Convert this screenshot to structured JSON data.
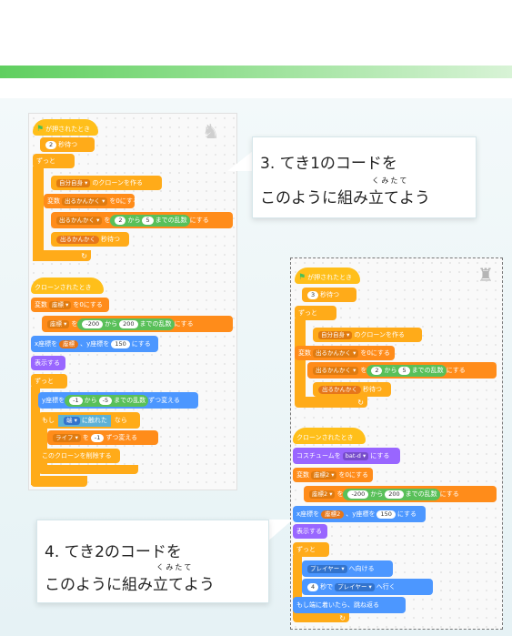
{
  "callout3": {
    "line1": "3.  てき1のコードを",
    "ruby": "くみたて",
    "line2": "このように組み立てよう"
  },
  "callout4": {
    "line1": "4.  てき2のコードを",
    "ruby": "くみたて",
    "line2": "このように組み立てよう"
  },
  "panel1": {
    "flag_hat": "が押されたとき",
    "wait_value": "2",
    "wait_label": "秒待つ",
    "forever": "ずっと",
    "clone_self": "自分自身 ▾",
    "clone_label": "のクローンを作る",
    "set_var": "変数",
    "set_var_name": "出るかんかく ▾",
    "set_var_to": "を0にする",
    "set_var_row": "出るかんかく ▾",
    "set_var_eq": "を",
    "rand_a": "2",
    "rand_from": "から",
    "rand_b": "5",
    "rand_label": "までの乱数",
    "rand_suffix": "にする",
    "wait_var": "出るかんかく",
    "wait_var_label": "秒待つ",
    "clone_hat": "クローンされたとき",
    "set2_var": "変数",
    "set2_name": "座標 ▾",
    "set2_label": "を0にする",
    "set2_row": "座標 ▾",
    "set2_eq": "を",
    "rand2_a": "-200",
    "rand2_from": "から",
    "rand2_b": "200",
    "rand2_label": "までの乱数",
    "rand2_suffix": "にする",
    "goto_x": "x座標を",
    "goto_x_var": "座標",
    "goto_y": "、y座標を",
    "goto_y_val": "150",
    "goto_suffix": "にする",
    "show": "表示する",
    "forever2": "ずっと",
    "change_y": "y座標を",
    "change_y_a": "-1",
    "change_y_from": "から",
    "change_y_b": "-5",
    "change_y_label": "までの乱数",
    "change_y_suffix": "ずつ変える",
    "if": "もし",
    "if_touch": "端 ▾",
    "if_touch_label": "に触れた",
    "if_then": "なら",
    "life": "ライフ ▾",
    "life_eq": "を",
    "life_val": "-1",
    "life_label": "ずつ変える",
    "delete_clone": "このクローンを削除する"
  },
  "panel2": {
    "flag_hat": "が押されたとき",
    "wait_value": "3",
    "wait_label": "秒待つ",
    "forever": "ずっと",
    "clone_self": "自分自身 ▾",
    "clone_label": "のクローンを作る",
    "set_var": "変数",
    "set_var_name": "出るかんかく ▾",
    "set_var_to": "を0にする",
    "set_var_row": "出るかんかく ▾",
    "set_var_eq": "を",
    "rand_a": "2",
    "rand_from": "から",
    "rand_b": "5",
    "rand_label": "までの乱数",
    "rand_suffix": "にする",
    "wait_var": "出るかんかく",
    "wait_var_label": "秒待つ",
    "clone_hat": "クローンされたとき",
    "costume": "コスチュームを",
    "costume_name": "bat-d ▾",
    "costume_suffix": "にする",
    "set2_var": "変数",
    "set2_name": "座標2 ▾",
    "set2_label": "を0にする",
    "set2_row": "座標2 ▾",
    "set2_eq": "を",
    "rand2_a": "-200",
    "rand2_from": "から",
    "rand2_b": "200",
    "rand2_label": "までの乱数",
    "rand2_suffix": "にする",
    "goto_x": "x座標を",
    "goto_x_var": "座標2",
    "goto_y": "、y座標を",
    "goto_y_val": "150",
    "goto_suffix": "にする",
    "show": "表示する",
    "forever2": "ずっと",
    "point": "プレイヤー ▾",
    "point_label": "へ向ける",
    "glide_val": "4",
    "glide_mid": "秒で",
    "glide_target": "プレイヤー ▾",
    "glide_suffix": "へ行く",
    "bounce": "もし端に着いたら、跳ね返る"
  }
}
